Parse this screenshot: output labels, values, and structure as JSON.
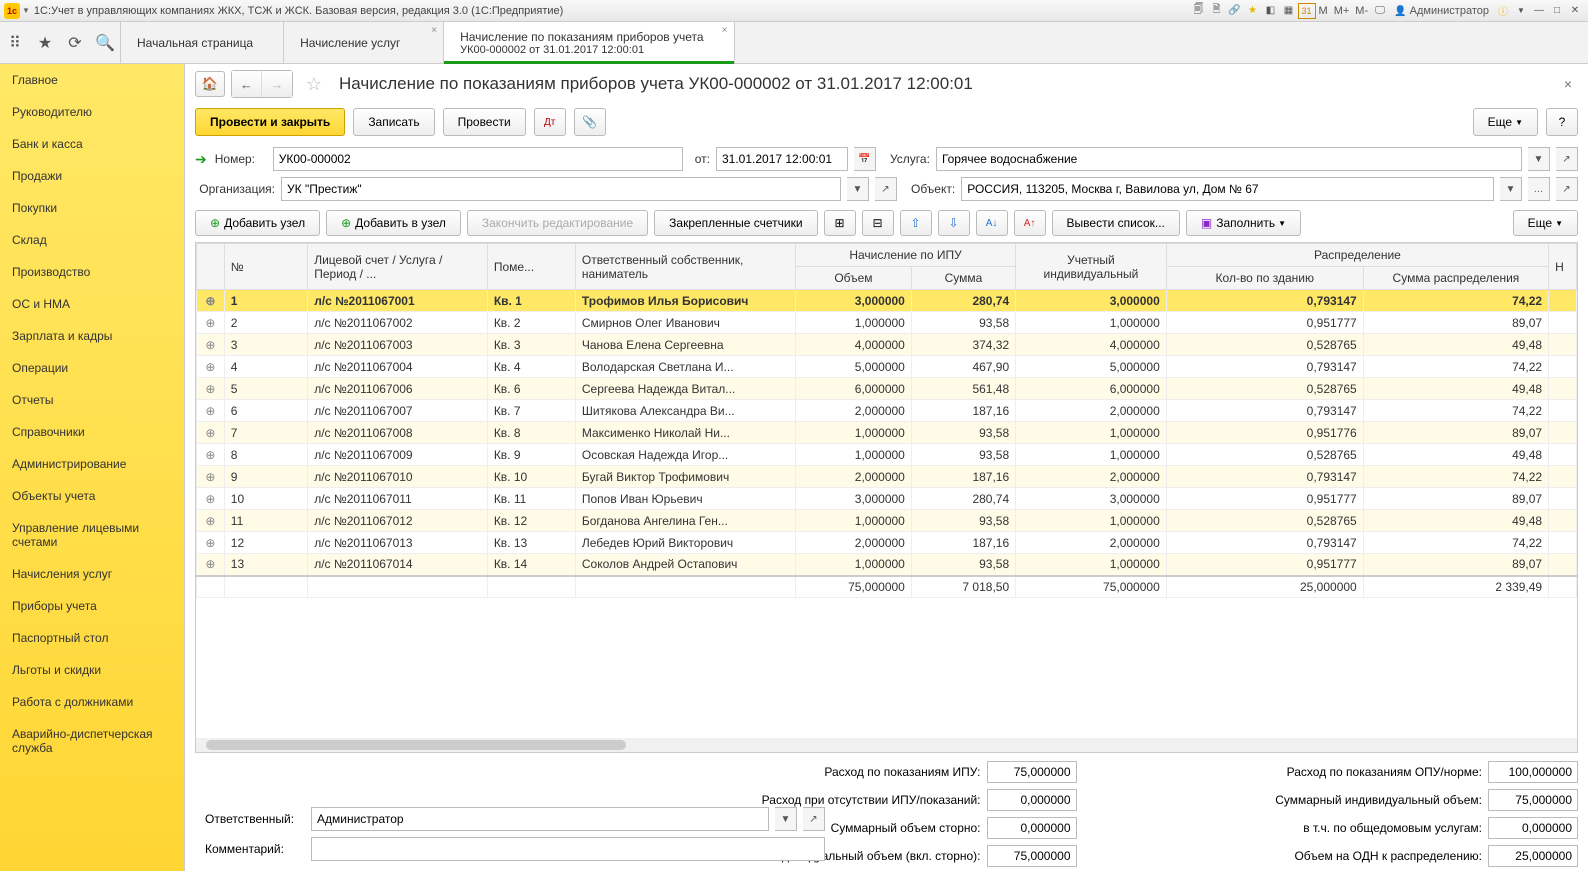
{
  "titlebar": {
    "title": "1С:Учет в управляющих компаниях ЖКХ, ТСЖ и ЖСК. Базовая версия, редакция 3.0  (1С:Предприятие)",
    "user": "Администратор",
    "m_buttons": [
      "M",
      "M+",
      "M-"
    ]
  },
  "tabs": {
    "home": "Начальная страница",
    "t1": "Начисление услуг",
    "t2_line1": "Начисление по показаниям приборов учета",
    "t2_line2": "УК00-000002 от 31.01.2017 12:00:01"
  },
  "sidebar": [
    "Главное",
    "Руководителю",
    "Банк и касса",
    "Продажи",
    "Покупки",
    "Склад",
    "Производство",
    "ОС и НМА",
    "Зарплата и кадры",
    "Операции",
    "Отчеты",
    "Справочники",
    "Администрирование",
    "Объекты учета",
    "Управление лицевыми счетами",
    "Начисления услуг",
    "Приборы учета",
    "Паспортный стол",
    "Льготы и скидки",
    "Работа с должниками",
    "Аварийно-диспетчерская служба"
  ],
  "page_title": "Начисление по показаниям приборов учета УК00-000002 от 31.01.2017 12:00:01",
  "toolbar": {
    "post_close": "Провести и закрыть",
    "write": "Записать",
    "post": "Провести",
    "more": "Еще",
    "help": "?"
  },
  "form": {
    "number_label": "Номер:",
    "number": "УК00-000002",
    "from_label": "от:",
    "date": "31.01.2017 12:00:01",
    "service_label": "Услуга:",
    "service": "Горячее водоснабжение",
    "org_label": "Организация:",
    "org": "УК \"Престиж\"",
    "object_label": "Объект:",
    "object": "РОССИЯ, 113205, Москва г, Вавилова ул, Дом № 67"
  },
  "gridtb": {
    "add_node": "Добавить узел",
    "add_in_node": "Добавить в узел",
    "end_edit": "Закончить редактирование",
    "pinned": "Закрепленные счетчики",
    "print_list": "Вывести список...",
    "fill": "Заполнить",
    "more": "Еще"
  },
  "grid_headers": {
    "no": "№",
    "account": "Лицевой счет / Услуга / Период / ...",
    "room": "Поме...",
    "owner": "Ответственный собственник, наниматель",
    "ipu": "Начисление по ИПУ",
    "volume": "Объем",
    "sum": "Сумма",
    "ind": "Учетный индивидуальный",
    "dist": "Распределение",
    "qty_b": "Кол-во по зданию",
    "sum_d": "Сумма распределения",
    "n": "Н"
  },
  "rows": [
    {
      "n": "1",
      "acc": "л/с №2011067001",
      "room": "Кв. 1",
      "owner": "Трофимов Илья Борисович",
      "vol": "3,000000",
      "sum": "280,74",
      "ind": "3,000000",
      "qb": "0,793147",
      "sd": "74,22"
    },
    {
      "n": "2",
      "acc": "л/с №2011067002",
      "room": "Кв. 2",
      "owner": "Смирнов Олег Иванович",
      "vol": "1,000000",
      "sum": "93,58",
      "ind": "1,000000",
      "qb": "0,951777",
      "sd": "89,07"
    },
    {
      "n": "3",
      "acc": "л/с №2011067003",
      "room": "Кв. 3",
      "owner": "Чанова Елена Сергеевна",
      "vol": "4,000000",
      "sum": "374,32",
      "ind": "4,000000",
      "qb": "0,528765",
      "sd": "49,48"
    },
    {
      "n": "4",
      "acc": "л/с №2011067004",
      "room": "Кв. 4",
      "owner": "Володарская Светлана И...",
      "vol": "5,000000",
      "sum": "467,90",
      "ind": "5,000000",
      "qb": "0,793147",
      "sd": "74,22"
    },
    {
      "n": "5",
      "acc": "л/с №2011067006",
      "room": "Кв. 6",
      "owner": "Сергеева Надежда Витал...",
      "vol": "6,000000",
      "sum": "561,48",
      "ind": "6,000000",
      "qb": "0,528765",
      "sd": "49,48"
    },
    {
      "n": "6",
      "acc": "л/с №2011067007",
      "room": "Кв. 7",
      "owner": "Шитякова Александра Ви...",
      "vol": "2,000000",
      "sum": "187,16",
      "ind": "2,000000",
      "qb": "0,793147",
      "sd": "74,22"
    },
    {
      "n": "7",
      "acc": "л/с №2011067008",
      "room": "Кв. 8",
      "owner": "Максименко Николай Ни...",
      "vol": "1,000000",
      "sum": "93,58",
      "ind": "1,000000",
      "qb": "0,951776",
      "sd": "89,07"
    },
    {
      "n": "8",
      "acc": "л/с №2011067009",
      "room": "Кв. 9",
      "owner": "Осовская Надежда Игор...",
      "vol": "1,000000",
      "sum": "93,58",
      "ind": "1,000000",
      "qb": "0,528765",
      "sd": "49,48"
    },
    {
      "n": "9",
      "acc": "л/с №2011067010",
      "room": "Кв. 10",
      "owner": "Бугай Виктор Трофимович",
      "vol": "2,000000",
      "sum": "187,16",
      "ind": "2,000000",
      "qb": "0,793147",
      "sd": "74,22"
    },
    {
      "n": "10",
      "acc": "л/с №2011067011",
      "room": "Кв. 11",
      "owner": "Попов Иван Юрьевич",
      "vol": "3,000000",
      "sum": "280,74",
      "ind": "3,000000",
      "qb": "0,951777",
      "sd": "89,07"
    },
    {
      "n": "11",
      "acc": "л/с №2011067012",
      "room": "Кв. 12",
      "owner": "Богданова Ангелина Ген...",
      "vol": "1,000000",
      "sum": "93,58",
      "ind": "1,000000",
      "qb": "0,528765",
      "sd": "49,48"
    },
    {
      "n": "12",
      "acc": "л/с №2011067013",
      "room": "Кв. 13",
      "owner": "Лебедев Юрий Викторович",
      "vol": "2,000000",
      "sum": "187,16",
      "ind": "2,000000",
      "qb": "0,793147",
      "sd": "74,22"
    },
    {
      "n": "13",
      "acc": "л/с №2011067014",
      "room": "Кв. 14",
      "owner": "Соколов Андрей Остапович",
      "vol": "1,000000",
      "sum": "93,58",
      "ind": "1,000000",
      "qb": "0,951777",
      "sd": "89,07"
    }
  ],
  "totals": {
    "vol": "75,000000",
    "sum": "7 018,50",
    "ind": "75,000000",
    "qb": "25,000000",
    "sd": "2 339,49"
  },
  "footer": {
    "r1l": "Расход по показаниям ИПУ:",
    "r1v": "75,000000",
    "r2l": "Расход при отсутствии ИПУ/показаний:",
    "r2v": "0,000000",
    "r3l": "Суммарный объем сторно:",
    "r3v": "0,000000",
    "r4l": "Итоговый индивидуальный объем (вкл. сторно):",
    "r4v": "75,000000",
    "c1l": "Расход по показаниям ОПУ/норме:",
    "c1v": "100,000000",
    "c2l": "Суммарный индивидуальный объем:",
    "c2v": "75,000000",
    "c3l": "в т.ч. по общедомовым услугам:",
    "c3v": "0,000000",
    "c4l": "Объем на ОДН к распределению:",
    "c4v": "25,000000"
  },
  "resp": {
    "label": "Ответственный:",
    "value": "Администратор"
  },
  "comment_label": "Комментарий:"
}
